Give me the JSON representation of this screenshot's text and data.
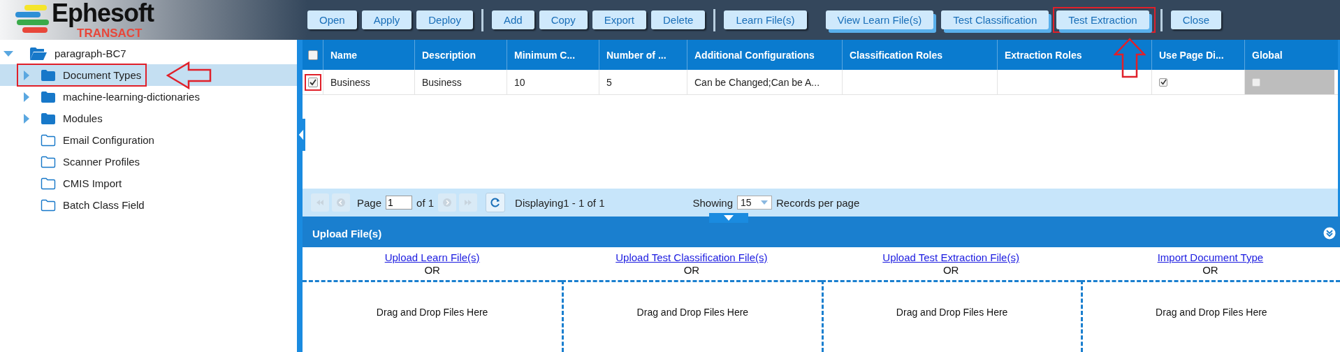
{
  "logo": {
    "name": "Ephesoft",
    "product": "TRANSACT"
  },
  "toolbar": [
    [
      {
        "label": "Open",
        "kind": "plain",
        "highlighted": false
      },
      {
        "label": "Apply",
        "kind": "plain",
        "highlighted": false
      },
      {
        "label": "Deploy",
        "kind": "plain",
        "highlighted": false
      }
    ],
    [
      {
        "label": "Add",
        "kind": "plain",
        "highlighted": false
      },
      {
        "label": "Copy",
        "kind": "plain",
        "highlighted": false
      },
      {
        "label": "Export",
        "kind": "plain",
        "highlighted": false
      },
      {
        "label": "Delete",
        "kind": "plain",
        "highlighted": false
      }
    ],
    [
      {
        "label": "Learn File(s)",
        "kind": "plain",
        "highlighted": false
      },
      {
        "label": "View Learn File(s)",
        "kind": "stacked",
        "highlighted": false
      },
      {
        "label": "Test Classification",
        "kind": "stacked",
        "highlighted": false
      },
      {
        "label": "Test Extraction",
        "kind": "stacked",
        "highlighted": true
      }
    ],
    [
      {
        "label": "Close",
        "kind": "plain",
        "highlighted": false
      }
    ]
  ],
  "tree": {
    "label": "paragraph-BC7",
    "expanded": true,
    "children": [
      {
        "label": "Document Types",
        "expandable": true,
        "expanded": false,
        "selected": true,
        "highlighted": true
      },
      {
        "label": "machine-learning-dictionaries",
        "expandable": true,
        "expanded": false,
        "selected": false,
        "highlighted": false
      },
      {
        "label": "Modules",
        "expandable": true,
        "expanded": false,
        "selected": false,
        "highlighted": false
      },
      {
        "label": "Email Configuration",
        "expandable": false,
        "selected": false,
        "highlighted": false
      },
      {
        "label": "Scanner Profiles",
        "expandable": false,
        "selected": false,
        "highlighted": false
      },
      {
        "label": "CMIS Import",
        "expandable": false,
        "selected": false,
        "highlighted": false
      },
      {
        "label": "Batch Class Field",
        "expandable": false,
        "selected": false,
        "highlighted": false
      }
    ]
  },
  "table": {
    "header_checked": false,
    "columns": [
      "Name",
      "Description",
      "Minimum C...",
      "Number of ...",
      "Additional Configurations",
      "Classification Roles",
      "Extraction Roles",
      "Use Page Di...",
      "Global"
    ],
    "rows": [
      {
        "checked": true,
        "highlighted": true,
        "name": "Business",
        "description": "Business",
        "minimum": "10",
        "number": "5",
        "additional": "Can be Changed;Can be A...",
        "use_page_checked": true,
        "global_checked": false,
        "global_disabled": true
      }
    ]
  },
  "pager": {
    "page_label": "Page",
    "page": "1",
    "of": "of 1",
    "displaying": "Displaying1 - 1 of 1",
    "showing": "Showing",
    "per_page": "15",
    "records": "Records per page"
  },
  "upload": {
    "title": "Upload File(s)",
    "columns": [
      {
        "link": "Upload Learn File(s)",
        "or": "OR",
        "drop": "Drag and Drop Files Here"
      },
      {
        "link": "Upload Test Classification File(s)",
        "or": "OR",
        "drop": "Drag and Drop Files Here"
      },
      {
        "link": "Upload Test Extraction File(s)",
        "or": "OR",
        "drop": "Drag and Drop Files Here"
      },
      {
        "link": "Import Document Type",
        "or": "OR",
        "drop": "Drag and Drop Files Here"
      }
    ]
  }
}
